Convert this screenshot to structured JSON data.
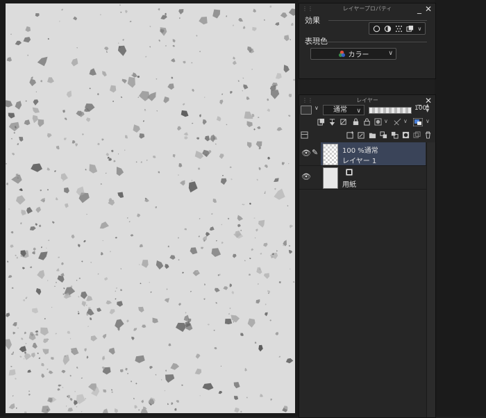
{
  "layer_property_panel": {
    "title": "レイヤープロパティ",
    "effects_label": "効果",
    "effect_icons": [
      "border-effect-icon",
      "tone-icon",
      "halftone-icon",
      "layer-color-icon"
    ],
    "expression_color_label": "表現色",
    "expression_color_value": "カラー"
  },
  "layer_panel": {
    "title": "レイヤー",
    "blend_mode": "通常",
    "opacity": "100",
    "layers": [
      {
        "line1": "100 %通常",
        "line2": "レイヤー 1",
        "selected": true
      },
      {
        "line1": "",
        "line2": "用紙",
        "selected": false
      }
    ]
  },
  "colors": {
    "selected_layer": "#3a4459",
    "panel_bg": "#262626",
    "canvas_paper": "#dcdcdc"
  }
}
